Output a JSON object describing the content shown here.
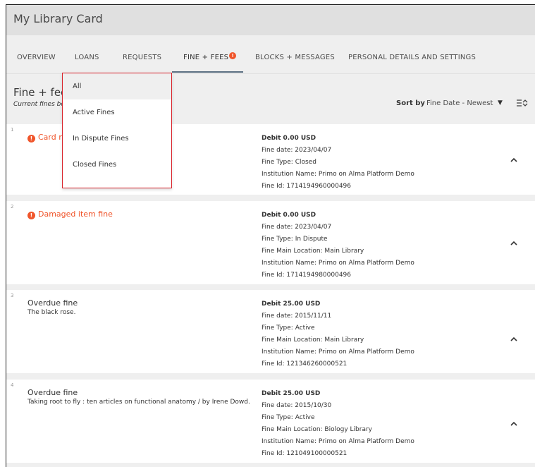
{
  "app": {
    "title": "My Library Card"
  },
  "tabs": [
    {
      "label": "OVERVIEW",
      "active": false
    },
    {
      "label": "LOANS",
      "active": false
    },
    {
      "label": "REQUESTS",
      "active": false
    },
    {
      "label": "FINE + FEES",
      "active": true,
      "badge": "!"
    },
    {
      "label": "BLOCKS + MESSAGES",
      "active": false
    },
    {
      "label": "PERSONAL DETAILS AND SETTINGS",
      "active": false
    }
  ],
  "section": {
    "title": "Fine + fees",
    "subtitle": "Current fines bo"
  },
  "sort": {
    "label": "Sort by",
    "value": "Fine Date - Newest",
    "caret": "▼"
  },
  "filter_dropdown": {
    "items": [
      "All",
      "Active Fines",
      "In Dispute Fines",
      "Closed Fines"
    ],
    "selected": "All"
  },
  "fines": [
    {
      "num": "1",
      "name": "Card re",
      "alert": true,
      "title": "",
      "debit": "Debit 0.00 USD",
      "lines": [
        "Fine date: 2023/04/07",
        "Fine Type: Closed",
        "Institution Name: Primo on Alma Platform Demo",
        "Fine Id: 1714194960000496"
      ]
    },
    {
      "num": "2",
      "name": "Damaged item fine",
      "alert": true,
      "title": "",
      "debit": "Debit 0.00 USD",
      "lines": [
        "Fine date: 2023/04/07",
        "Fine Type: In Dispute",
        "Fine Main Location: Main Library",
        "Institution Name: Primo on Alma Platform Demo",
        "Fine Id: 1714194980000496"
      ]
    },
    {
      "num": "3",
      "name": "Overdue fine",
      "alert": false,
      "title": "The black rose.",
      "debit": "Debit 25.00 USD",
      "lines": [
        "Fine date: 2015/11/11",
        "Fine Type: Active",
        "Fine Main Location: Main Library",
        "Institution Name: Primo on Alma Platform Demo",
        "Fine Id: 121346260000521"
      ]
    },
    {
      "num": "4",
      "name": "Overdue fine",
      "alert": false,
      "title": "Taking root to fly : ten articles on functional anatomy / by Irene Dowd.",
      "debit": "Debit 25.00 USD",
      "lines": [
        "Fine date: 2015/10/30",
        "Fine Type: Active",
        "Fine Main Location: Biology Library",
        "Institution Name: Primo on Alma Platform Demo",
        "Fine Id: 121049100000521"
      ]
    }
  ],
  "colors": {
    "alert": "#f0552b",
    "dropdown_border": "#d9222a",
    "tab_underline": "#5b6f82",
    "header_bg": "#e0e0e0"
  },
  "icons": {
    "row_toggle": "chevron-up-icon",
    "sort_menu": "sort-lines-icon",
    "fine_alert": "exclamation-circle-icon"
  }
}
